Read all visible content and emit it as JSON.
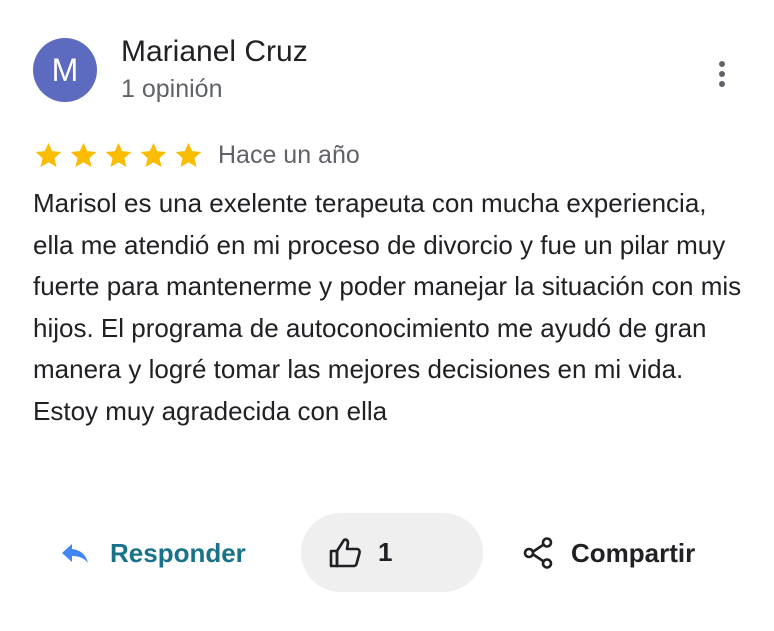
{
  "reviewer": {
    "initial": "M",
    "avatar_color": "#5c6bc0",
    "name": "Marianel Cruz",
    "meta": "1 opinión"
  },
  "more_menu": {
    "icon": "more-vert-icon"
  },
  "review": {
    "rating": 5,
    "max_rating": 5,
    "star_color": "#fbbc04",
    "time": "Hace un año",
    "text": "Marisol es una exelente terapeuta con mucha experiencia, ella me atendió en mi proceso de divorcio y fue un pilar muy fuerte para mantenerme y poder manejar la situación con mis hijos. El programa de autoconocimiento me ayudó de gran manera y logré tomar las mejores decisiones en mi vida. Estoy muy agradecida con ella"
  },
  "actions": {
    "reply": {
      "label": "Responder",
      "icon": "reply-icon",
      "color": "#18738a",
      "icon_color": "#4285f4"
    },
    "like": {
      "count": "1",
      "icon": "thumb-up-icon",
      "background": "#efefef"
    },
    "share": {
      "label": "Compartir",
      "icon": "share-icon"
    }
  }
}
